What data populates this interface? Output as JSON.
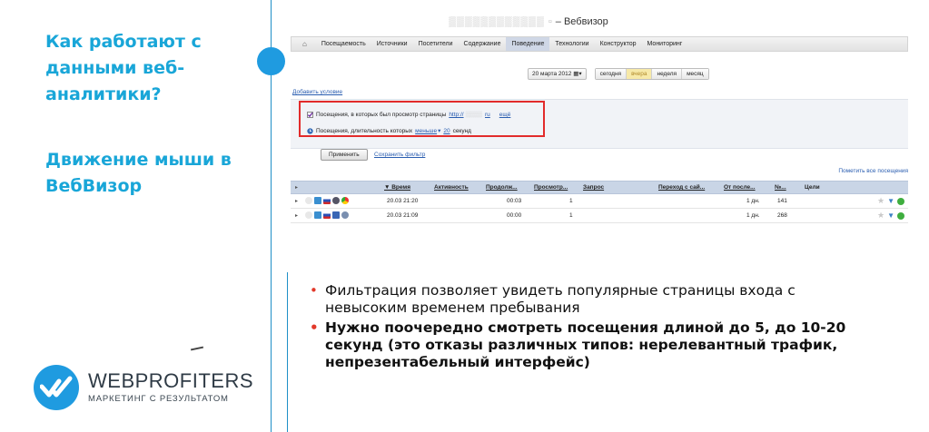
{
  "left": {
    "heading1": "Как работают с данными веб-аналитики?",
    "heading2": "Движение мыши в ВебВизор"
  },
  "logo": {
    "name": "WEBPROFITERS",
    "tagline": "МАРКЕТИНГ С РЕЗУЛЬТАТОМ"
  },
  "screenshot": {
    "title_suffix": "– Вебвизор",
    "nav": {
      "items": [
        "Посещаемость",
        "Источники",
        "Посетители",
        "Содержание",
        "Поведение",
        "Технологии",
        "Конструктор",
        "Мониторинг"
      ],
      "active": "Поведение"
    },
    "datebar": {
      "date": "20 марта 2012",
      "periods": [
        "сегодня",
        "вчера",
        "неделя",
        "месяц"
      ],
      "selected": "вчера"
    },
    "add_condition": "Добавить условие",
    "conditions": {
      "c1_text": "Посещения, в которых был просмотр страницы",
      "c1_url": "http://",
      "c1_tld": "ru",
      "c1_more": "ещё",
      "c2_text": "Посещения, длительность которых",
      "c2_op": "меньше",
      "c2_value": "20",
      "c2_unit": "секунд"
    },
    "apply_label": "Применить",
    "save_filter": "Сохранить фильтр",
    "mark_all": "Пометить все посещения",
    "table": {
      "headers": [
        "▼ Время",
        "Активность",
        "Продолж...",
        "Просмотр...",
        "Запрос",
        "Переход с сай...",
        "От после...",
        "№...",
        "Цели"
      ],
      "rows": [
        {
          "time": "20.03 21:20",
          "duration": "00:03",
          "views": "1",
          "since": "1 дн.",
          "num": "141"
        },
        {
          "time": "20.03 21:09",
          "duration": "00:00",
          "views": "1",
          "since": "1 дн.",
          "num": "268"
        }
      ]
    }
  },
  "bullets": {
    "b1": "Фильтрация позволяет увидеть популярные страницы входа с невысоким временем пребывания",
    "b2": "Нужно поочередно смотреть посещения длиной до 5, до 10-20 секунд (это отказы различных типов: нерелевантный трафик, непрезентабельный интерфейс)"
  },
  "colors": {
    "accent": "#19a6d8",
    "highlight_box": "#e22b2b",
    "bullet": "#e2392a"
  }
}
